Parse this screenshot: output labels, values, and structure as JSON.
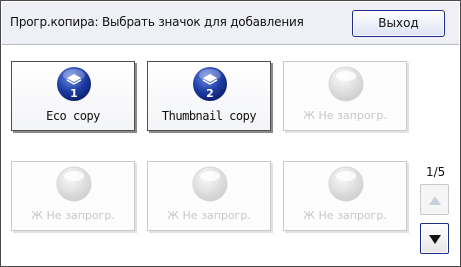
{
  "header": {
    "title": "Прогр.копира: Выбрать значок для добавления",
    "exit_label": "Выход"
  },
  "tiles": [
    {
      "label": "Eco copy",
      "number": "1",
      "state": "enabled",
      "icon": "copy-program-icon"
    },
    {
      "label": "Thumbnail copy",
      "number": "2",
      "state": "enabled",
      "icon": "copy-program-icon"
    },
    {
      "label": "Ж Не запрогр.",
      "state": "disabled",
      "icon": "empty-program-icon"
    },
    {
      "label": "Ж Не запрогр.",
      "state": "disabled",
      "icon": "empty-program-icon"
    },
    {
      "label": "Ж Не запрогр.",
      "state": "disabled",
      "icon": "empty-program-icon"
    },
    {
      "label": "Ж Не запрогр.",
      "state": "disabled",
      "icon": "empty-program-icon"
    }
  ],
  "pagination": {
    "page_indicator": "1/5"
  },
  "colors": {
    "accent_blue": "#1d3fa8",
    "disabled_text": "#c6c6c6",
    "button_border": "#1d2f8a"
  }
}
